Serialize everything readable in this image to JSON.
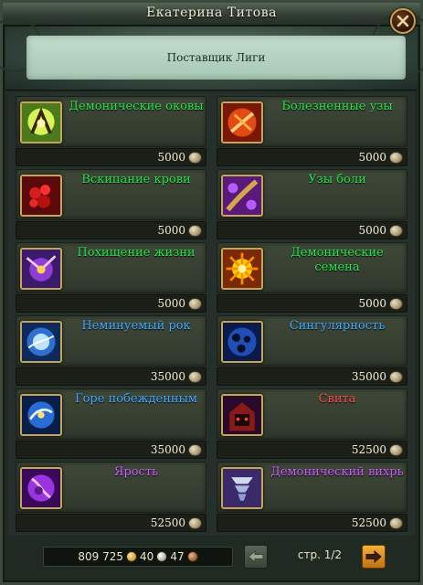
{
  "window": {
    "title": "Екатерина Титова"
  },
  "vendor": {
    "name": "Поставщик Лиги"
  },
  "colors": {
    "green": "#27e24f",
    "blue": "#41a9ff",
    "purple": "#c85cff",
    "red": "#ff4e4e"
  },
  "items": [
    {
      "name": "Демонические оковы",
      "price": "5000",
      "color": "green",
      "icon": "demonic-shackles-icon"
    },
    {
      "name": "Болезненные узы",
      "price": "5000",
      "color": "green",
      "icon": "painful-bonds-icon"
    },
    {
      "name": "Вскипание крови",
      "price": "5000",
      "color": "green",
      "icon": "blood-boil-icon"
    },
    {
      "name": "Узы боли",
      "price": "5000",
      "color": "green",
      "icon": "bonds-of-pain-icon"
    },
    {
      "name": "Похищение жизни",
      "price": "5000",
      "color": "green",
      "icon": "life-steal-icon"
    },
    {
      "name": "Демонические семена",
      "price": "5000",
      "color": "green",
      "icon": "demonic-seeds-icon"
    },
    {
      "name": "Неминуемый рок",
      "price": "35000",
      "color": "blue",
      "icon": "inevitable-doom-icon"
    },
    {
      "name": "Сингулярность",
      "price": "35000",
      "color": "blue",
      "icon": "singularity-icon"
    },
    {
      "name": "Горе побежденным",
      "price": "35000",
      "color": "blue",
      "icon": "woe-to-vanquished-icon"
    },
    {
      "name": "Свита",
      "price": "52500",
      "color": "red",
      "icon": "retinue-icon"
    },
    {
      "name": "Ярость",
      "price": "52500",
      "color": "purple",
      "icon": "fury-icon"
    },
    {
      "name": "Демонический вихрь",
      "price": "52500",
      "color": "purple",
      "icon": "demonic-whirlwind-icon"
    }
  ],
  "footer": {
    "money_gold": "809 725",
    "money_silver": "40",
    "money_copper": "47",
    "page_label": "стр. 1/2"
  }
}
